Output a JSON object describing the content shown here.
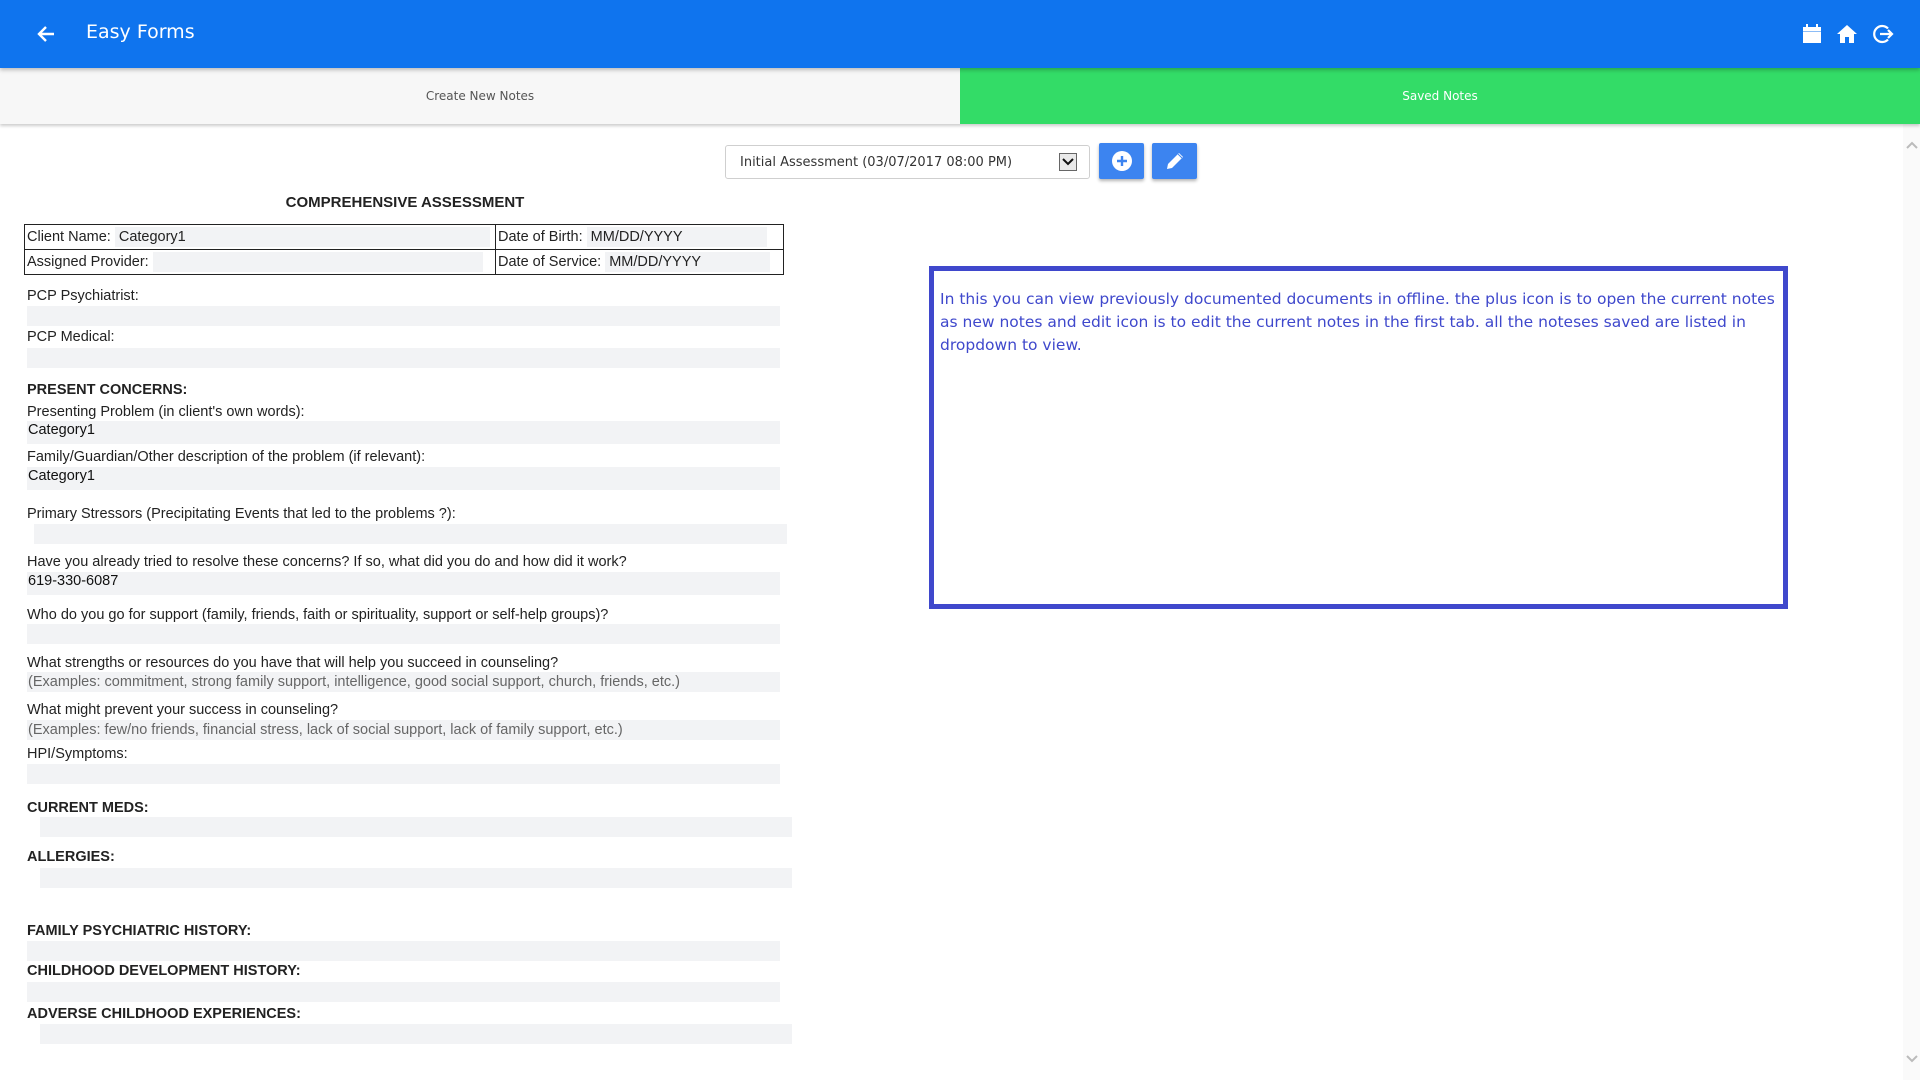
{
  "app": {
    "title": "Easy Forms",
    "colors": {
      "appbar": "#0f74ee",
      "active_tab": "#33dc67",
      "button": "#3c84f0",
      "annotation": "#3f48cc"
    },
    "header_icons": [
      "calendar-icon",
      "home-icon",
      "logout-icon"
    ]
  },
  "tabs": [
    {
      "label": "Create New Notes",
      "active": false
    },
    {
      "label": "Saved Notes",
      "active": true
    }
  ],
  "toolbar": {
    "selected_note": "Initial Assessment (03/07/2017 08:00 PM)",
    "add_button_icon": "plus-circle-icon",
    "edit_button_icon": "pencil-icon"
  },
  "form": {
    "title": "COMPREHENSIVE ASSESSMENT",
    "header": {
      "client_name_label": "Client Name:",
      "client_name_value": "Category1",
      "dob_label": "Date of Birth:",
      "dob_value": "MM/DD/YYYY",
      "provider_label": "Assigned Provider:",
      "provider_value": "",
      "dos_label": "Date of Service:",
      "dos_value": "MM/DD/YYYY"
    },
    "fields": [
      {
        "label": "PCP Psychiatrist:",
        "value": ""
      },
      {
        "label": "PCP Medical:",
        "value": ""
      },
      {
        "label": "PRESENT CONCERNS:",
        "section": true
      },
      {
        "label": "Presenting Problem (in client's own words):",
        "value": "Category1"
      },
      {
        "label": "Family/Guardian/Other description of the problem (if relevant):",
        "value": "Category1"
      },
      {
        "label": "Primary Stressors (Precipitating Events that led to the problems ?):",
        "value": ""
      },
      {
        "label": "Have you already tried to resolve these concerns? If so, what did you do and how did it work?",
        "value": "619-330-6087"
      },
      {
        "label": "Who do you go for support (family, friends, faith or spirituality, support or self-help groups)?",
        "value": ""
      },
      {
        "label": "What strengths or resources do you have that will help you succeed in counseling?",
        "placeholder": "(Examples: commitment, strong family support, intelligence, good social support, church, friends, etc.)"
      },
      {
        "label": "What might prevent your success in counseling?",
        "placeholder": "(Examples: few/no friends, financial stress, lack of social support, lack of family support, etc.)"
      },
      {
        "label": "HPI/Symptoms:",
        "value": ""
      },
      {
        "label": "CURRENT MEDS:",
        "value": ""
      },
      {
        "label": "ALLERGIES:",
        "value": ""
      },
      {
        "label": "FAMILY PSYCHIATRIC HISTORY:",
        "value": ""
      },
      {
        "label": "CHILDHOOD DEVELOPMENT HISTORY:",
        "value": ""
      },
      {
        "label": "ADVERSE CHILDHOOD EXPERIENCES:",
        "value": ""
      }
    ]
  },
  "annotation": {
    "text": "In this you can view previously documented documents in offline. the plus icon is to open the current notes as new notes and edit icon is to edit the current notes in the first tab. all the noteses saved are listed in dropdown to view."
  }
}
